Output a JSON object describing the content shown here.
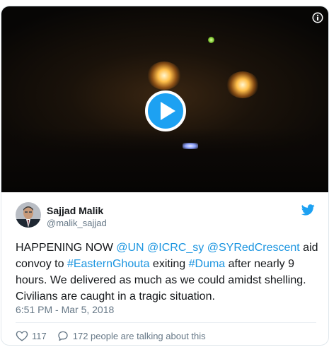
{
  "media": {
    "play_label": "Play video",
    "info_icon": "info-icon"
  },
  "author": {
    "name": "Sajjad Malik",
    "handle": "@malik_sajjad"
  },
  "tweet": {
    "segments": [
      {
        "text": "HAPPENING NOW ",
        "link": false
      },
      {
        "text": "@UN",
        "link": true
      },
      {
        "text": " ",
        "link": false
      },
      {
        "text": "@ICRC_sy",
        "link": true
      },
      {
        "text": " ",
        "link": false
      },
      {
        "text": "@SYRedCrescent",
        "link": true
      },
      {
        "text": " aid convoy to ",
        "link": false
      },
      {
        "text": "#EasternGhouta",
        "link": true
      },
      {
        "text": " exiting ",
        "link": false
      },
      {
        "text": "#Duma",
        "link": true
      },
      {
        "text": " after nearly 9 hours. We delivered as much as we could amidst shelling. Civilians are caught in a tragic situation.",
        "link": false
      }
    ],
    "timestamp": "6:51 PM - Mar 5, 2018"
  },
  "actions": {
    "likes": "117",
    "conversation": "172 people are talking about this"
  },
  "colors": {
    "link": "#1b95e0",
    "muted": "#657786",
    "twitter_blue": "#1da1f2"
  }
}
